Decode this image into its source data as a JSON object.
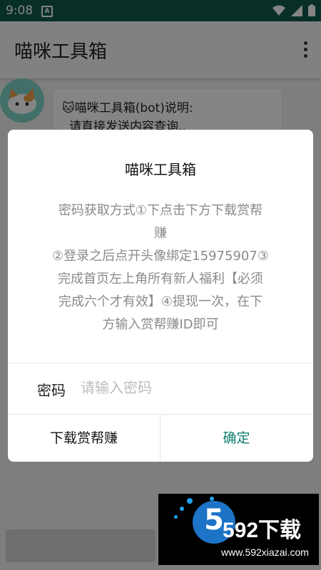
{
  "status_bar": {
    "time": "9:08",
    "app_badge": "A"
  },
  "toolbar": {
    "title": "喵咪工具箱",
    "menu_icon": "more-vert-icon"
  },
  "chat": {
    "bubble_line1": "🐱喵咪工具箱(bot)说明:",
    "bubble_line2": "请直接发送内容查询.."
  },
  "dialog": {
    "title": "喵咪工具箱",
    "message_lines": [
      "密码获取方式①下点击下方下载赏帮",
      "赚",
      "②登录之后点开头像绑定15975907③",
      "完成首页左上角所有新人福利【必须",
      "完成六个才有效】④提现一次，在下",
      "方输入赏帮赚ID即可"
    ],
    "password_label": "密码",
    "password_placeholder": "请输入密码",
    "password_value": "",
    "download_button": "下载赏帮赚",
    "confirm_button": "确定"
  },
  "watermark": {
    "logo_digit": "5",
    "brand": "592下载",
    "url": "www.592xiazai.com"
  },
  "colors": {
    "status_bar": "#0f5a4e",
    "accent": "#0f7d6b",
    "message_gray": "#8a8a8a"
  }
}
